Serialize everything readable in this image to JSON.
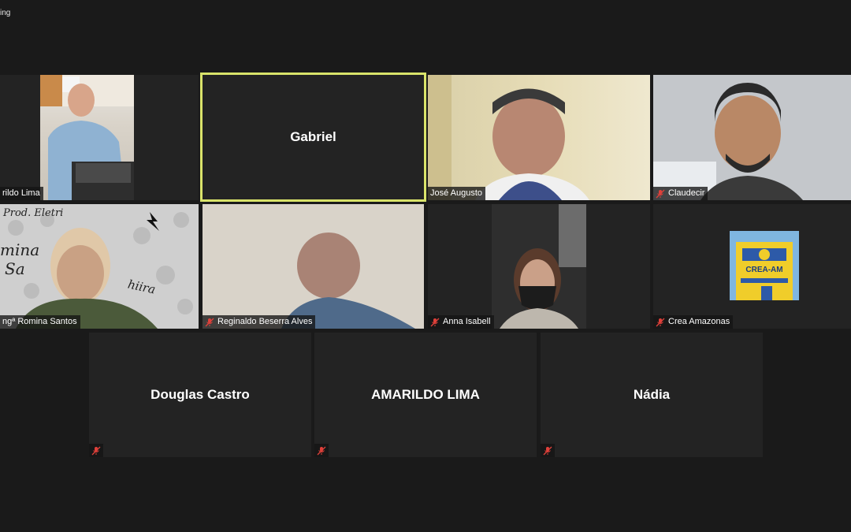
{
  "status": {
    "text": "ing"
  },
  "participants": {
    "amarildo_video": {
      "name": "rildo Lima"
    },
    "gabriel": {
      "name": "Gabriel"
    },
    "jose": {
      "name": "José Augusto"
    },
    "claudecir": {
      "name": "Claudecir"
    },
    "romina": {
      "name": "ngª Romina Santos",
      "background_text": [
        "Prod. Eletri",
        "mina",
        "Sa",
        "hiira"
      ]
    },
    "reginaldo": {
      "name": "Reginaldo Beserra Alves"
    },
    "anna": {
      "name": "Anna Isabell"
    },
    "crea": {
      "name": "Crea Amazonas",
      "logo_text": "CREA-AM"
    },
    "douglas": {
      "name": "Douglas Castro"
    },
    "amarildo": {
      "name": "AMARILDO LIMA"
    },
    "nadia": {
      "name": "Nádia"
    }
  },
  "colors": {
    "background": "#1a1a1a",
    "tile": "#232323",
    "active_speaker_border": "#d9e36a",
    "mute_icon": "#e0403a"
  },
  "icons": {
    "mute": "microphone-muted-icon"
  }
}
